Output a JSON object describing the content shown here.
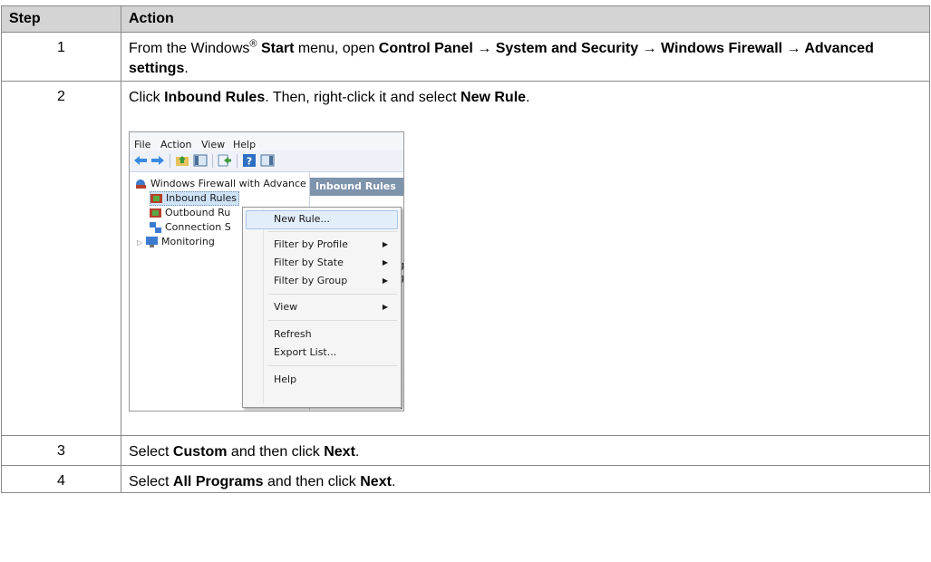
{
  "table": {
    "headers": {
      "step": "Step",
      "action": "Action"
    },
    "rows": [
      {
        "step": "1",
        "a1": "From the Windows",
        "reg": "®",
        "a2": " ",
        "b1": "Start",
        "a3": " menu, open ",
        "b2": "Control Panel → System and Security → Windows Firewall → Advanced settings",
        "a4": "."
      },
      {
        "step": "2",
        "a1": "Click ",
        "b1": "Inbound Rules",
        "a2": ". Then, right-click it and select ",
        "b2": "New Rule",
        "a3": "."
      },
      {
        "step": "3",
        "a1": "Select ",
        "b1": "Custom",
        "a2": " and then click ",
        "b2": "Next",
        "a3": "."
      },
      {
        "step": "4",
        "a1": "Select ",
        "b1": "All Programs",
        "a2": " and then click ",
        "b2": "Next",
        "a3": "."
      }
    ]
  },
  "screenshot": {
    "menu": [
      "File",
      "Action",
      "View",
      "Help"
    ],
    "toolbar_icons": [
      "back-arrow-icon",
      "forward-arrow-icon",
      "up-folder-icon",
      "show-hide-tree-icon",
      "export-icon",
      "help-icon",
      "action-pane-icon"
    ],
    "tree": [
      {
        "label": "Windows Firewall with Advance",
        "icon": "firewall-icon"
      },
      {
        "label": "Inbound Rules",
        "icon": "inbound-rules-icon"
      },
      {
        "label": "Outbound Ru",
        "icon": "outbound-rules-icon"
      },
      {
        "label": "Connection S",
        "icon": "connection-security-icon"
      },
      {
        "label": "Monitoring",
        "icon": "monitoring-icon"
      }
    ],
    "panel_header": "Inbound Rules",
    "context_menu": [
      {
        "label": "New Rule...",
        "submenu": false
      },
      {
        "label": "Filter by Profile",
        "submenu": true
      },
      {
        "label": "Filter by State",
        "submenu": true
      },
      {
        "label": "Filter by Group",
        "submenu": true
      },
      {
        "label": "View",
        "submenu": true
      },
      {
        "label": "Refresh",
        "submenu": false
      },
      {
        "label": "Export List...",
        "submenu": false
      },
      {
        "label": "Help",
        "submenu": false
      }
    ],
    "colors": {
      "header_bg": "#d4d4d4",
      "panel_header_bg": "#7e93ac",
      "selection_bg": "#e3eefb"
    }
  }
}
